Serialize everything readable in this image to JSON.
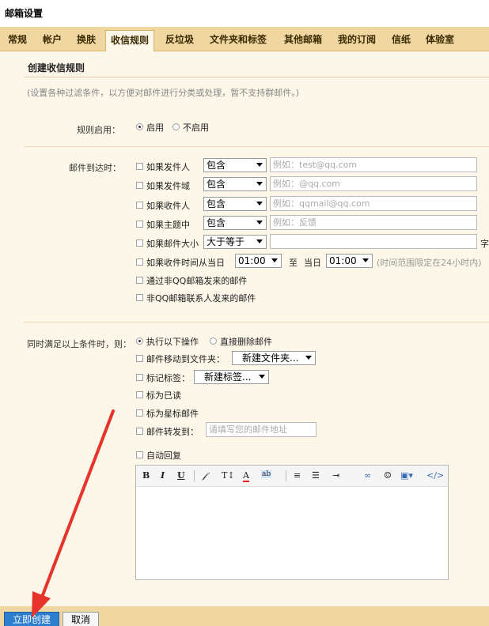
{
  "window_title": "邮箱设置",
  "tabs": [
    "常规",
    "帐户",
    "换肤",
    "收信规则",
    "反垃圾",
    "文件夹和标签",
    "其他邮箱",
    "我的订阅",
    "信纸",
    "体验室"
  ],
  "active_tab": "收信规则",
  "section_title": "创建收信规则",
  "description": "(设置各种过滤条件，以方便对邮件进行分类或处理，暂不支持群邮件。)",
  "rule_enable": {
    "label": "规则启用：",
    "on_label": "启用",
    "off_label": "不启用",
    "selected": "启用"
  },
  "conditions": {
    "label": "邮件到达时：",
    "rows": [
      {
        "label": "如果发件人",
        "op": "包含",
        "placeholder": "例如：test@qq.com"
      },
      {
        "label": "如果发件域",
        "op": "包含",
        "placeholder": "例如：@qq.com"
      },
      {
        "label": "如果收件人",
        "op": "包含",
        "placeholder": "例如：qqmail@qq.com"
      },
      {
        "label": "如果主题中",
        "op": "包含",
        "placeholder": "例如：反馈"
      },
      {
        "label": "如果邮件大小",
        "op": "大于等于",
        "placeholder": "",
        "unit": "字"
      }
    ],
    "time_row": {
      "label": "如果收件时间从当日",
      "from": "01:00",
      "to_label": "至",
      "day_label": "当日",
      "to": "01:00",
      "note": "(时间范围限定在24小时内)"
    },
    "extra": [
      "通过非QQ邮箱发来的邮件",
      "非QQ邮箱联系人发来的邮件"
    ]
  },
  "actions": {
    "label": "同时满足以上条件时，则：",
    "mode_execute": "执行以下操作",
    "mode_delete": "直接删除邮件",
    "move_label": "邮件移动到文件夹：",
    "move_value": "新建文件夹...",
    "tag_label": "标记标签：",
    "tag_value": "新建标签...",
    "mark_read": "标为已读",
    "mark_star": "标为星标邮件",
    "forward_label": "邮件转发到：",
    "forward_placeholder": "请填写您的邮件地址",
    "auto_reply": "自动回复"
  },
  "editor_toolbar": [
    "bold-icon",
    "italic-icon",
    "underline-icon",
    "font-icon",
    "font-size-icon",
    "font-color-icon",
    "background-color-icon",
    "align-icon",
    "list-icon",
    "indent-icon",
    "link-icon",
    "emoji-icon",
    "image-icon",
    "source-icon"
  ],
  "buttons": {
    "create": "立即创建",
    "cancel": "取消"
  },
  "colors": {
    "tab_bar": "#f0d6a0",
    "panel": "#fdf7e9",
    "primary": "#2f7fd0",
    "annotation_arrow": "#e8332b"
  }
}
